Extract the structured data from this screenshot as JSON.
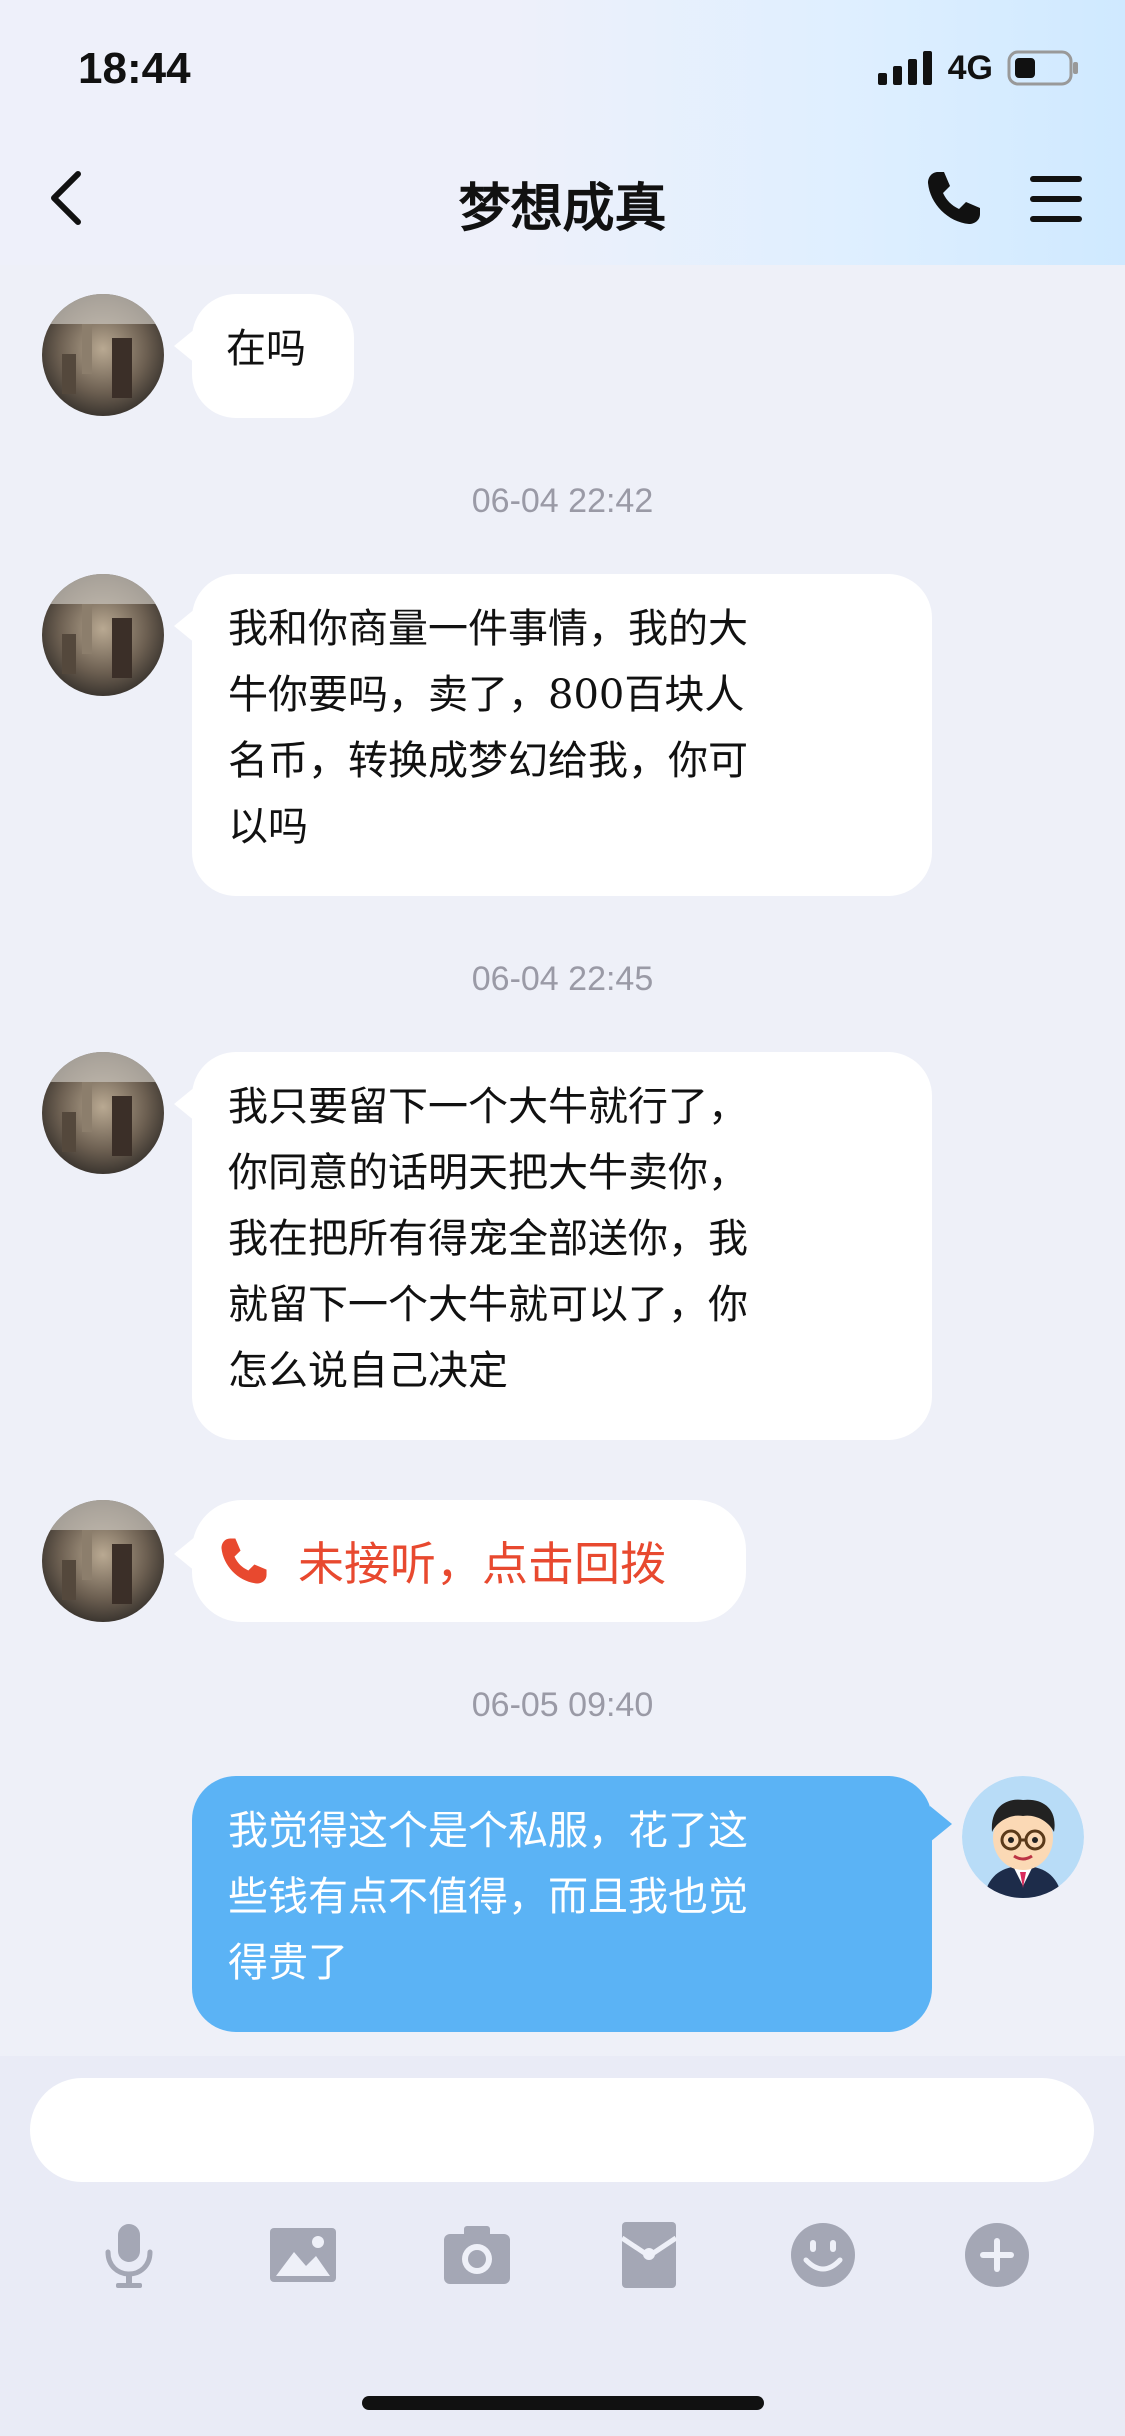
{
  "status_bar": {
    "time": "18:44",
    "network": "4G"
  },
  "header": {
    "title": "梦想成真"
  },
  "messages": [
    {
      "from": "them",
      "text": "在吗"
    },
    {
      "timestamp": "06-04 22:42"
    },
    {
      "from": "them",
      "lines": [
        "我和你商量一件事情，我的大",
        "牛你要吗，卖了，800百块人",
        "名币，转换成梦幻给我，你可",
        "以吗"
      ]
    },
    {
      "timestamp": "06-04 22:45"
    },
    {
      "from": "them",
      "lines": [
        "我只要留下一个大牛就行了，",
        "你同意的话明天把大牛卖你，",
        "我在把所有得宠全部送你，我",
        "就留下一个大牛就可以了，你",
        "怎么说自己决定"
      ]
    },
    {
      "from": "them",
      "missed_call": "未接听，点击回拨"
    },
    {
      "timestamp": "06-05 09:40"
    },
    {
      "from": "me",
      "lines": [
        "我觉得这个是个私服，花了这",
        "些钱有点不值得，而且我也觉",
        "得贵了"
      ]
    }
  ],
  "toolbar": {
    "icons": [
      "microphone-icon",
      "image-icon",
      "camera-icon",
      "red-packet-icon",
      "emoji-icon",
      "plus-icon"
    ]
  },
  "colors": {
    "me_bubble": "#5bb3f5",
    "missed_call": "#e8492f",
    "timestamp": "#9a9aa6"
  }
}
